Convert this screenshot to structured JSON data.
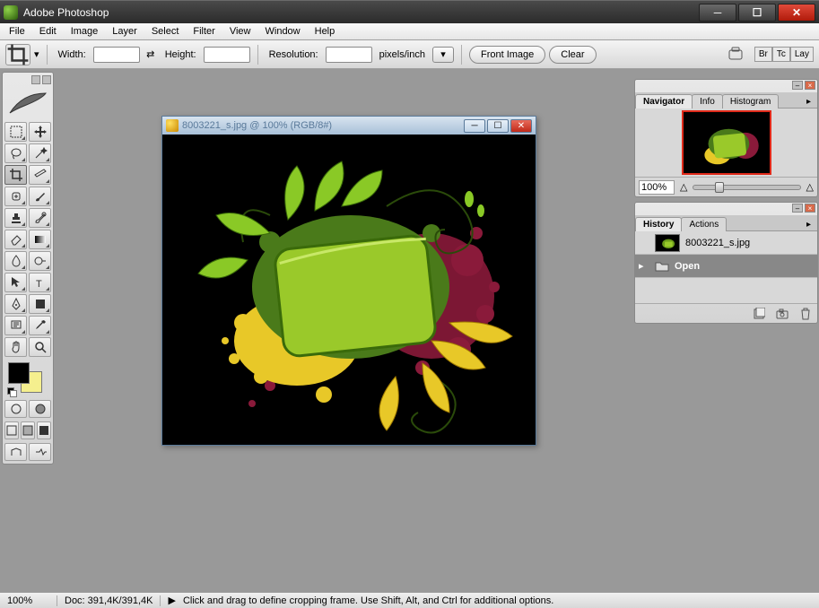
{
  "app": {
    "title": "Adobe Photoshop"
  },
  "window_controls": {
    "min": "_",
    "max": "☐",
    "close": "✕"
  },
  "menu": [
    "File",
    "Edit",
    "Image",
    "Layer",
    "Select",
    "Filter",
    "View",
    "Window",
    "Help"
  ],
  "options": {
    "width_label": "Width:",
    "width_value": "",
    "height_label": "Height:",
    "height_value": "",
    "resolution_label": "Resolution:",
    "resolution_value": "",
    "units": "pixels/inch",
    "front_image": "Front Image",
    "clear": "Clear"
  },
  "right_tabs": [
    "Br",
    "Tc",
    "Lay"
  ],
  "toolbox": {
    "foreground_color": "#000000",
    "background_color": "#f5ef8e"
  },
  "document": {
    "title": "8003221_s.jpg @ 100% (RGB/8#)",
    "filename": "8003221_s.jpg"
  },
  "navigator": {
    "tabs": [
      "Navigator",
      "Info",
      "Histogram"
    ],
    "zoom": "100%"
  },
  "history": {
    "tabs": [
      "History",
      "Actions"
    ],
    "snapshot": "8003221_s.jpg",
    "steps": [
      {
        "name": "Open"
      }
    ]
  },
  "status": {
    "zoom": "100%",
    "doc": "Doc: 391,4K/391,4K",
    "hint": "Click and drag to define cropping frame. Use Shift, Alt, and Ctrl for additional options."
  }
}
